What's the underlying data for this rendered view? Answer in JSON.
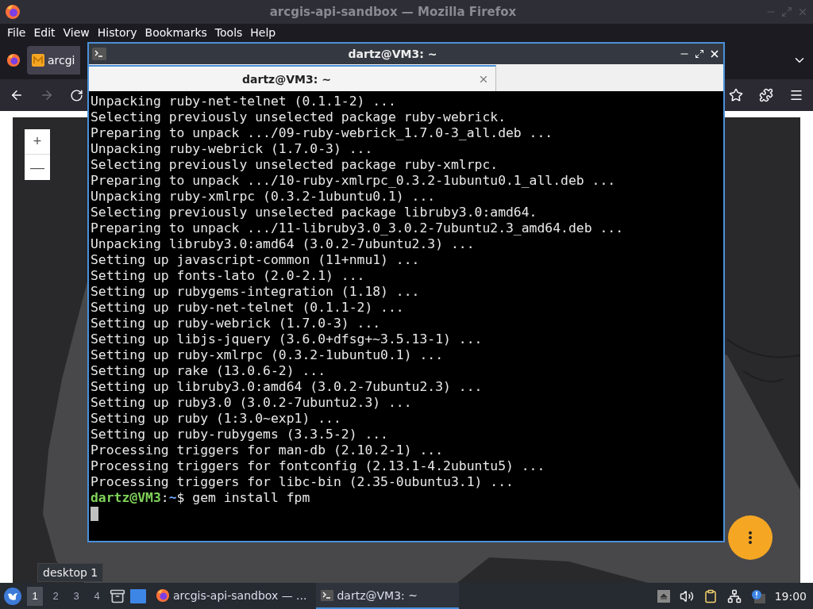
{
  "firefox": {
    "title": "arcgis-api-sandbox — Mozilla Firefox",
    "menu": [
      "File",
      "Edit",
      "View",
      "History",
      "Bookmarks",
      "Tools",
      "Help"
    ],
    "tabs": [
      {
        "label": "arcgi",
        "selected": true
      }
    ],
    "nav": {
      "back_disabled": false,
      "forward_disabled": true
    }
  },
  "map": {
    "zoom_in": "+",
    "zoom_out": "—"
  },
  "terminal": {
    "title": "dartz@VM3: ~",
    "tabs": [
      {
        "label": "dartz@VM3: ~",
        "selected": true
      }
    ],
    "lines": [
      "Unpacking ruby-net-telnet (0.1.1-2) ...",
      "Selecting previously unselected package ruby-webrick.",
      "Preparing to unpack .../09-ruby-webrick_1.7.0-3_all.deb ...",
      "Unpacking ruby-webrick (1.7.0-3) ...",
      "Selecting previously unselected package ruby-xmlrpc.",
      "Preparing to unpack .../10-ruby-xmlrpc_0.3.2-1ubuntu0.1_all.deb ...",
      "Unpacking ruby-xmlrpc (0.3.2-1ubuntu0.1) ...",
      "Selecting previously unselected package libruby3.0:amd64.",
      "Preparing to unpack .../11-libruby3.0_3.0.2-7ubuntu2.3_amd64.deb ...",
      "Unpacking libruby3.0:amd64 (3.0.2-7ubuntu2.3) ...",
      "Setting up javascript-common (11+nmu1) ...",
      "Setting up fonts-lato (2.0-2.1) ...",
      "Setting up rubygems-integration (1.18) ...",
      "Setting up ruby-net-telnet (0.1.1-2) ...",
      "Setting up ruby-webrick (1.7.0-3) ...",
      "Setting up libjs-jquery (3.6.0+dfsg+~3.5.13-1) ...",
      "Setting up ruby-xmlrpc (0.3.2-1ubuntu0.1) ...",
      "Setting up rake (13.0.6-2) ...",
      "Setting up libruby3.0:amd64 (3.0.2-7ubuntu2.3) ...",
      "Setting up ruby3.0 (3.0.2-7ubuntu2.3) ...",
      "Setting up ruby (1:3.0~exp1) ...",
      "Setting up ruby-rubygems (3.3.5-2) ...",
      "Processing triggers for man-db (2.10.2-1) ...",
      "Processing triggers for fontconfig (2.13.1-4.2ubuntu5) ...",
      "Processing triggers for libc-bin (2.35-0ubuntu3.1) ..."
    ],
    "prompt": {
      "user": "dartz@VM3",
      "separator": ":",
      "path": "~",
      "command": "$ gem install fpm"
    },
    "cursor": true
  },
  "taskbar": {
    "workspaces": [
      {
        "label": "1",
        "selected": true
      },
      {
        "label": "2",
        "selected": false
      },
      {
        "label": "3",
        "selected": false
      },
      {
        "label": "4",
        "selected": false
      }
    ],
    "tooltip": "desktop 1",
    "tasks": [
      {
        "kind": "browser",
        "label": "arcgis-api-sandbox — ...",
        "selected": false
      },
      {
        "kind": "terminal",
        "label": "dartz@VM3: ~",
        "selected": true
      }
    ],
    "clock": "19:00"
  }
}
